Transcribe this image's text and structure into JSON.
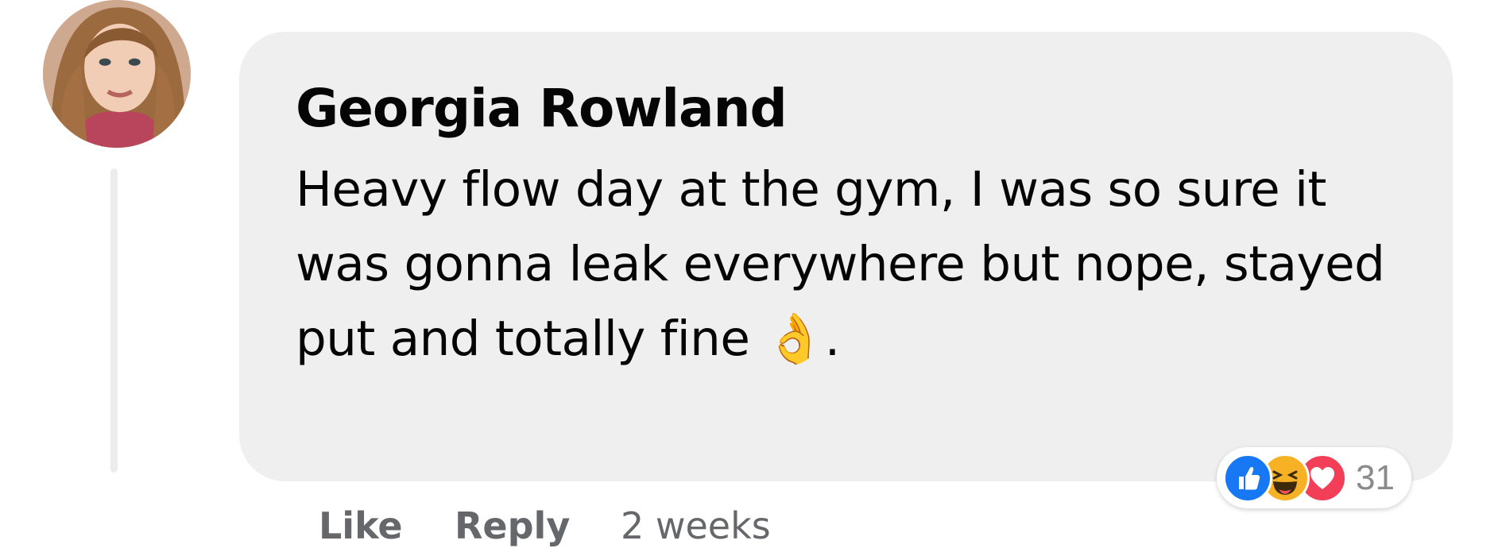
{
  "comment": {
    "author": "Georgia Rowland",
    "text": "Heavy flow day at the gym, I was so sure it was gonna leak everywhere but nope, stayed put and totally fine 👌."
  },
  "reactions": {
    "icons": [
      "like-icon",
      "haha-icon",
      "love-icon"
    ],
    "count": "31",
    "colors": {
      "like": "#1877f2",
      "haha": "#f7b125",
      "love": "#f33e58"
    }
  },
  "actions": {
    "like_label": "Like",
    "reply_label": "Reply",
    "timestamp": "2 weeks"
  },
  "colors": {
    "bubble_background": "#efefef",
    "text": "#050505",
    "secondary_text": "#65676b",
    "thread_line": "#ececec"
  }
}
